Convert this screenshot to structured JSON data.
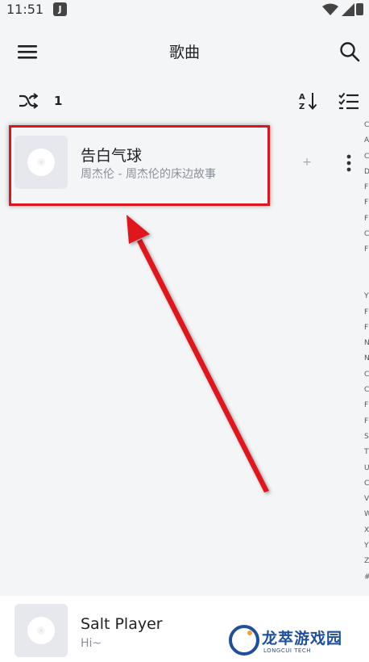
{
  "status_bar": {
    "time": "11:51",
    "app_badge": "J"
  },
  "app_bar": {
    "title": "歌曲",
    "menu_icon": "hamburger-menu-icon",
    "search_icon": "search-icon"
  },
  "toolbar": {
    "shuffle_icon": "shuffle-icon",
    "count": "1",
    "sort_icon": "sort-az-icon",
    "multiselect_icon": "checklist-icon"
  },
  "songs": [
    {
      "title": "告白气球",
      "subtitle": "周杰伦 - 周杰伦的床边故事",
      "add_label": "+",
      "more_icon": "more-vert-icon",
      "cover_icon": "disc-icon"
    }
  ],
  "player": {
    "title": "Salt Player",
    "subtitle": "Hi~",
    "cover_icon": "disc-icon"
  },
  "watermark": {
    "text": "龙萃游戏园",
    "sub": "LONGCUI TECH"
  },
  "side_letters": [
    "C",
    "A",
    "C",
    "D",
    "F",
    "F",
    "F",
    "C",
    "F",
    "",
    "",
    "Y",
    "F",
    "F",
    "N",
    "N",
    "C",
    "C",
    "F",
    "F",
    "S",
    "T",
    "U",
    "C",
    "V",
    "W",
    "X",
    "Y",
    "Z",
    "#"
  ],
  "colors": {
    "highlight": "#e0141b",
    "background": "#f4f5f7",
    "watermark": "#1e4f9b"
  }
}
